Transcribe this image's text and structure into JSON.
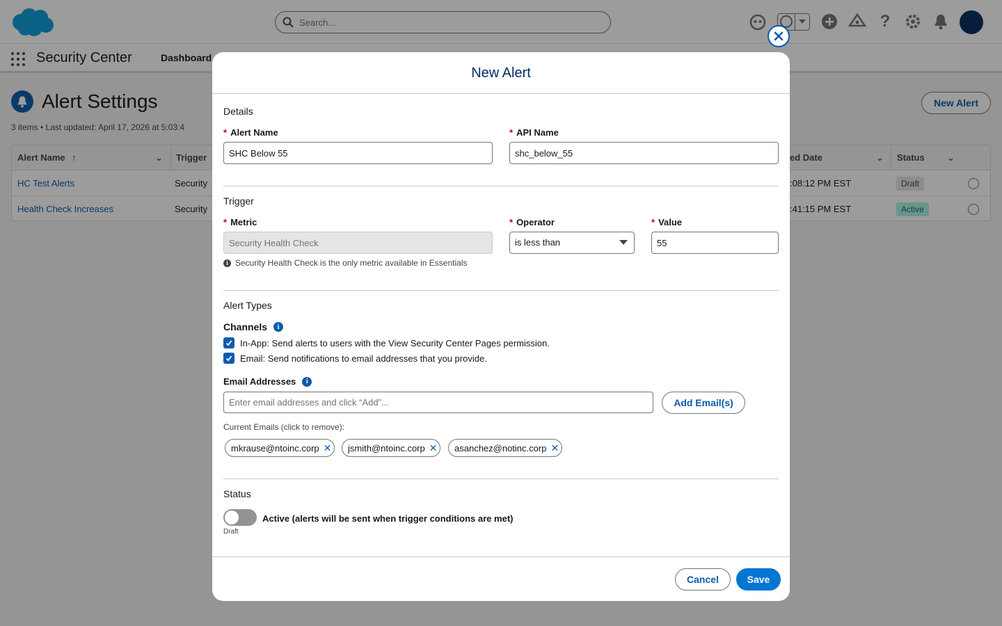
{
  "header": {
    "search_placeholder": "Search..."
  },
  "nav": {
    "app_name": "Security Center",
    "tab_dashboard": "Dashboard"
  },
  "list": {
    "title": "Alert Settings",
    "meta": "3 items • Last updated: April 17, 2026 at 5:03:4",
    "new_alert_label": "New Alert",
    "columns": {
      "alert_name": "Alert Name",
      "trigger": "Trigger",
      "date": "ed Date",
      "status": "Status"
    },
    "rows": [
      {
        "name": "HC Test Alerts",
        "trigger": "Security",
        "date": ":08:12 PM EST",
        "status": "Draft"
      },
      {
        "name": "Health Check Increases",
        "trigger": "Security",
        "date": ":41:15 PM EST",
        "status": "Active"
      }
    ]
  },
  "modal": {
    "title": "New Alert",
    "details": {
      "section_title": "Details",
      "alert_name_label": "Alert Name",
      "alert_name_value": "SHC Below 55",
      "api_name_label": "API Name",
      "api_name_value": "shc_below_55"
    },
    "trigger": {
      "section_title": "Trigger",
      "metric_label": "Metric",
      "metric_value": "Security Health Check",
      "metric_help": "Security Health Check is the only metric available in Essentials",
      "operator_label": "Operator",
      "operator_value": "is less than",
      "value_label": "Value",
      "value_value": "55"
    },
    "alert_types": {
      "section_title": "Alert Types",
      "channels_label": "Channels",
      "inapp_label": "In-App: Send alerts to users with the View Security Center Pages permission.",
      "email_label": "Email: Send notifications to email addresses that you provide.",
      "email_addresses_label": "Email Addresses",
      "email_placeholder": "Enter email addresses and click “Add”...",
      "add_emails_label": "Add Email(s)",
      "current_emails_label": "Current Emails (click to remove):",
      "emails": [
        "mkrause@ntoinc.corp",
        "jsmith@ntoinc.corp",
        "asanchez@notinc.corp"
      ]
    },
    "status": {
      "section_title": "Status",
      "toggle_label": "Active (alerts will be sent when trigger conditions are met)",
      "toggle_state_text": "Draft",
      "active": false
    },
    "footer": {
      "cancel_label": "Cancel",
      "save_label": "Save"
    }
  },
  "colors": {
    "brand": "#0176d3",
    "link": "#0b5cab",
    "title": "#032d60",
    "required": "#ba0517"
  }
}
